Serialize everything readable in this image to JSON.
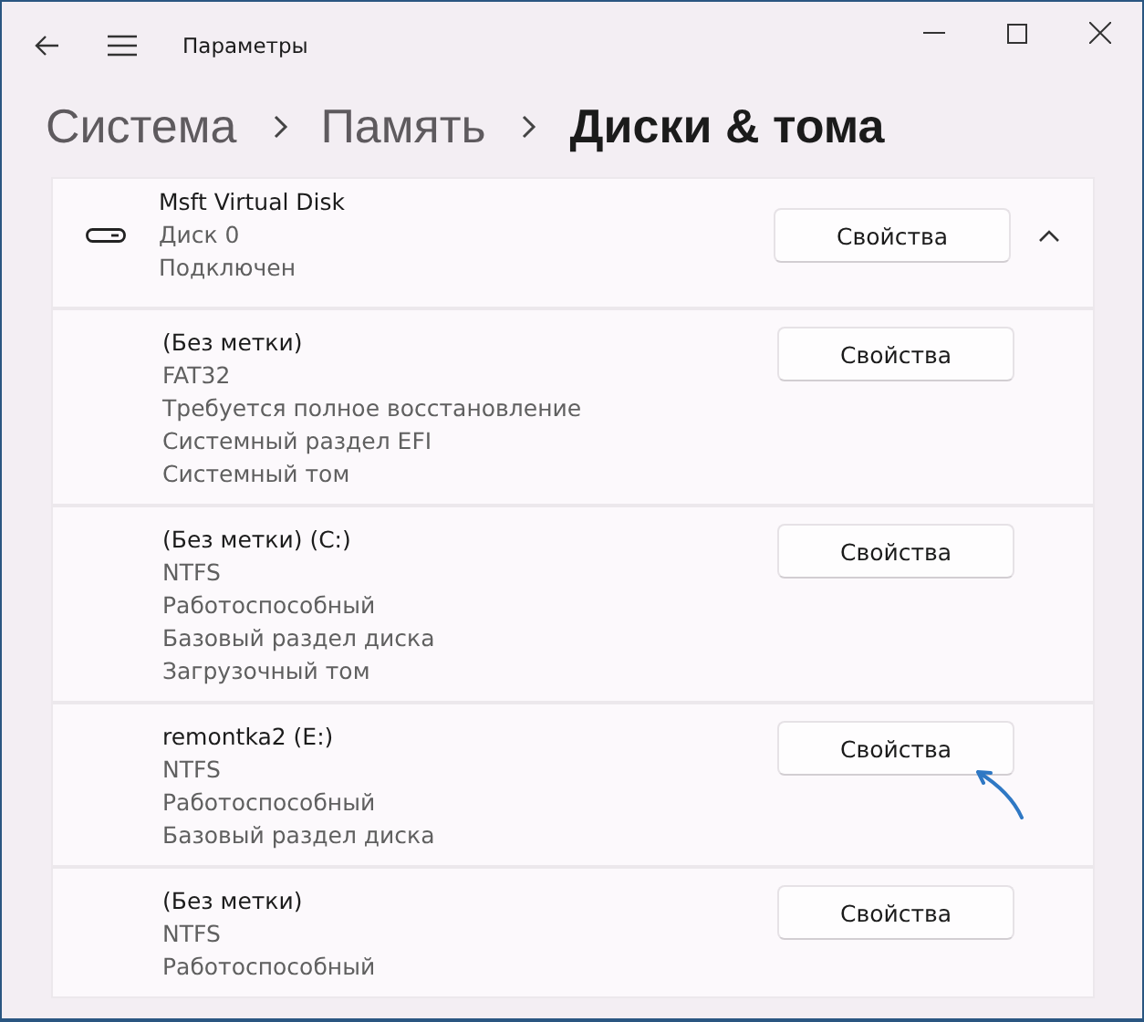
{
  "window": {
    "title": "Параметры"
  },
  "breadcrumb": [
    {
      "label": "Система",
      "current": false
    },
    {
      "label": "Память",
      "current": false
    },
    {
      "label": "Диски & тома",
      "current": true
    }
  ],
  "disk": {
    "name": "Msft Virtual Disk",
    "details": [
      "Диск 0",
      "Подключен"
    ],
    "button": "Свойства",
    "expanded": true
  },
  "volumes": [
    {
      "name": "(Без метки)",
      "details": [
        "FAT32",
        "Требуется полное восстановление",
        "Системный раздел EFI",
        "Системный том"
      ],
      "button": "Свойства",
      "highlighted": false
    },
    {
      "name": "(Без метки) (C:)",
      "details": [
        "NTFS",
        "Работоспособный",
        "Базовый раздел диска",
        "Загрузочный том"
      ],
      "button": "Свойства",
      "highlighted": false
    },
    {
      "name": "remontka2 (E:)",
      "details": [
        "NTFS",
        "Работоспособный",
        "Базовый раздел диска"
      ],
      "button": "Свойства",
      "highlighted": true
    },
    {
      "name": "(Без метки)",
      "details": [
        "NTFS",
        "Работоспособный"
      ],
      "button": "Свойства",
      "highlighted": false
    }
  ]
}
